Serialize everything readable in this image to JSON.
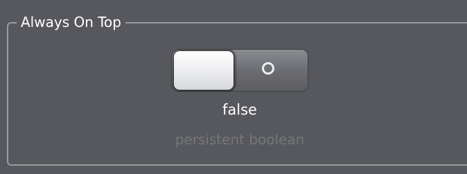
{
  "groupbox": {
    "title": "Always On Top"
  },
  "toggle": {
    "checked": false,
    "off_icon": "circle-icon"
  },
  "value_text": "false",
  "description": "persistent boolean",
  "colors": {
    "background": "#57585d",
    "border": "#9b9ca0",
    "text": "#ffffff",
    "muted_text": "#75767a"
  }
}
